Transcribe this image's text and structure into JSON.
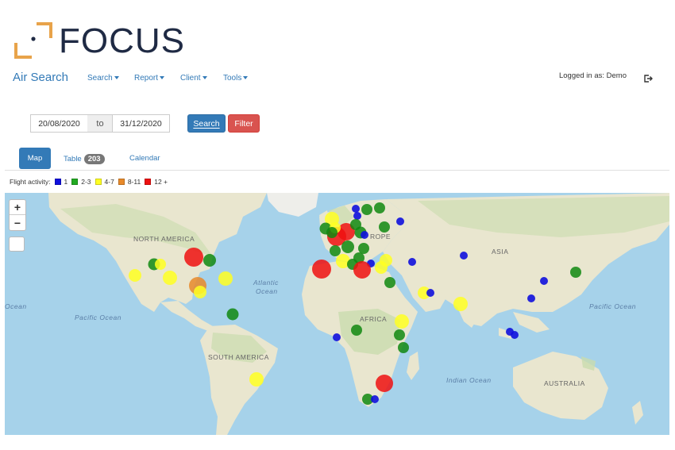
{
  "brand": {
    "name": "FOCUS",
    "accent": "#e8a34a",
    "dark": "#1f2a44"
  },
  "header": {
    "app_title": "Air Search",
    "menus": [
      {
        "label": "Search"
      },
      {
        "label": "Report"
      },
      {
        "label": "Client"
      },
      {
        "label": "Tools"
      }
    ],
    "logged_in": "Logged in as: Demo",
    "logout_icon": "logout-icon"
  },
  "filters": {
    "date_from": "20/08/2020",
    "date_sep": "to",
    "date_to": "31/12/2020",
    "search_label": "Search",
    "filter_label": "Filter"
  },
  "tabs": {
    "map": "Map",
    "table": "Table",
    "table_count": "203",
    "calendar": "Calendar"
  },
  "legend": {
    "title": "Flight activity:",
    "items": [
      {
        "label": "1",
        "color": "#1010dd"
      },
      {
        "label": "2-3",
        "color": "#22aa22"
      },
      {
        "label": "4-7",
        "color": "#ffff22"
      },
      {
        "label": "8-11",
        "color": "#e88a2a"
      },
      {
        "label": "12 +",
        "color": "#ee1111"
      }
    ]
  },
  "map": {
    "zoom_in": "+",
    "zoom_out": "−",
    "labels": {
      "north_america": "NORTH AMERICA",
      "south_america": "SOUTH AMERICA",
      "europe": "ROPE",
      "asia": "ASIA",
      "africa": "AFRICA",
      "australia": "AUSTRALIA",
      "atlantic": "Atlantic",
      "atlantic2": "Ocean",
      "pacific_left": "Pacific Ocean",
      "pacific_right": "Pacific Ocean",
      "indian": "Indian Ocean",
      "ocean_edge": "Ocean"
    },
    "colors": {
      "sea": "#a6d2ea",
      "land": "#e9e6cf",
      "veg": "#c9dcae"
    }
  }
}
